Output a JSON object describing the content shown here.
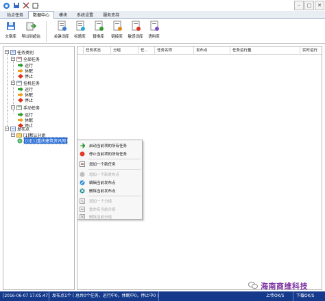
{
  "tabs": [
    "站点任务",
    "数据中心",
    "模块",
    "系统设置",
    "服务支持"
  ],
  "active_tab": 1,
  "ribbon": {
    "group1": [
      {
        "label": "文章库",
        "icon": "article-db-icon"
      },
      {
        "label": "导出到超站",
        "icon": "export-icon"
      }
    ],
    "group2": [
      {
        "label": "关键词库",
        "icon": "keyword-db-icon"
      },
      {
        "label": "标题库",
        "icon": "title-db-icon"
      },
      {
        "label": "替换库",
        "icon": "replace-db-icon"
      },
      {
        "label": "链接库",
        "icon": "link-db-icon"
      },
      {
        "label": "敏感词库",
        "icon": "sensitive-db-icon"
      },
      {
        "label": "语料库",
        "icon": "corpus-db-icon"
      }
    ]
  },
  "tree": {
    "root": "任务类别",
    "groups": [
      {
        "label": "全部任务",
        "children": [
          "运行",
          "休眠",
          "停止"
        ]
      },
      {
        "label": "挂机任务",
        "children": [
          "运行",
          "休眠",
          "停止"
        ]
      },
      {
        "label": "手动任务",
        "children": [
          "运行",
          "休眠",
          "停止"
        ]
      }
    ],
    "publish_root": "发布点",
    "default_group": "[1]默认分组",
    "selected_site": "[0][1]重庆建筑资讯网"
  },
  "grid": {
    "columns": [
      "任务状态",
      "分组",
      "任...",
      "任务名称",
      "发布点",
      "任务运行量",
      "实时运行"
    ]
  },
  "context_menu": [
    {
      "label": "启动当前项的所有任务",
      "icon": "play-icon",
      "enabled": true,
      "color": "#2e9b2e"
    },
    {
      "label": "停止当前项的所有任务",
      "icon": "stop-icon",
      "enabled": true,
      "color": "#e03a2a"
    },
    {
      "sep": true
    },
    {
      "label": "增加一个新任务",
      "icon": "new-task-icon",
      "enabled": true,
      "color": "#c0392b"
    },
    {
      "sep": true
    },
    {
      "label": "增加一个新发布点",
      "icon": "add-publish-icon",
      "enabled": false,
      "color": "#9a9a9a"
    },
    {
      "label": "编辑当前发布点",
      "icon": "edit-publish-icon",
      "enabled": true,
      "color": "#2f8fd8"
    },
    {
      "label": "删除当前发布点",
      "icon": "delete-publish-icon",
      "enabled": true,
      "color": "#1d8a8a"
    },
    {
      "sep": true
    },
    {
      "label": "增加一个分组",
      "icon": "add-group-icon",
      "enabled": false,
      "color": "#9a9a9a"
    },
    {
      "label": "重命名当前分组",
      "icon": "rename-group-icon",
      "enabled": false,
      "color": "#9a9a9a"
    },
    {
      "label": "删除当前分组",
      "icon": "delete-group-icon",
      "enabled": false,
      "color": "#9a9a9a"
    }
  ],
  "status": {
    "time": "[2016-06-07 17:05:47]",
    "summary": "发布点1个 ( 总共0个任务，运行中0，休眠中0，停止中0 )",
    "net1": "上传OK/S",
    "net2": "下载OK/S"
  },
  "watermark": "海南商维科技",
  "colors": {
    "status_bg": "#153a8c",
    "selection": "#2b6fd6",
    "run_green": "#2e9b2e",
    "sleep_orange": "#f0a020",
    "stop_red": "#d8331f",
    "watermark": "#7a2ea0"
  }
}
